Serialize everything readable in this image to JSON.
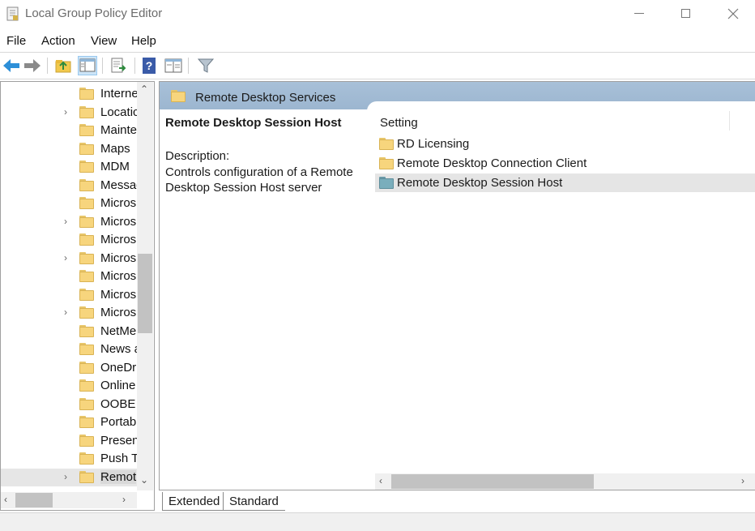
{
  "window": {
    "title": "Local Group Policy Editor",
    "icon": "policy-editor-icon"
  },
  "menu": {
    "items": [
      "File",
      "Action",
      "View",
      "Help"
    ]
  },
  "toolbar": {
    "icons": [
      "back-arrow-icon",
      "forward-arrow-icon",
      "up-folder-icon",
      "show-hide-tree-icon",
      "export-list-icon",
      "help-icon",
      "extended-view-icon",
      "filter-icon"
    ]
  },
  "tree": {
    "items": [
      {
        "label": "Interne",
        "expandable": false
      },
      {
        "label": "Locatic",
        "expandable": true
      },
      {
        "label": "Mainte",
        "expandable": false
      },
      {
        "label": "Maps",
        "expandable": false
      },
      {
        "label": "MDM",
        "expandable": false
      },
      {
        "label": "Messag",
        "expandable": false
      },
      {
        "label": "Micros",
        "expandable": false
      },
      {
        "label": "Micros",
        "expandable": true
      },
      {
        "label": "Micros",
        "expandable": false
      },
      {
        "label": "Micros",
        "expandable": true
      },
      {
        "label": "Micros",
        "expandable": false
      },
      {
        "label": "Micros",
        "expandable": false
      },
      {
        "label": "Micros",
        "expandable": true
      },
      {
        "label": "NetMe",
        "expandable": false
      },
      {
        "label": "News a",
        "expandable": false
      },
      {
        "label": "OneDr",
        "expandable": false
      },
      {
        "label": "Online",
        "expandable": false
      },
      {
        "label": "OOBE",
        "expandable": false
      },
      {
        "label": "Portab",
        "expandable": false
      },
      {
        "label": "Presen",
        "expandable": false
      },
      {
        "label": "Push T",
        "expandable": false
      },
      {
        "label": "Remot",
        "expandable": true,
        "selected": true
      }
    ]
  },
  "right_pane": {
    "header_title": "Remote Desktop Services",
    "description_title": "Remote Desktop Session Host",
    "description_label": "Description:",
    "description_text": "Controls configuration of a Remote Desktop Session Host server",
    "column_header": "Setting",
    "items": [
      {
        "label": "RD Licensing",
        "selected": false
      },
      {
        "label": "Remote Desktop Connection Client",
        "selected": false
      },
      {
        "label": "Remote Desktop Session Host",
        "selected": true
      }
    ]
  },
  "tabs": {
    "extended": "Extended",
    "standard": "Standard"
  },
  "colors": {
    "header_blue": "#a8c0d8",
    "folder_yellow": "#f7d57d",
    "selected_folder": "#7aaebc",
    "selection_gray": "#e5e5e5"
  }
}
